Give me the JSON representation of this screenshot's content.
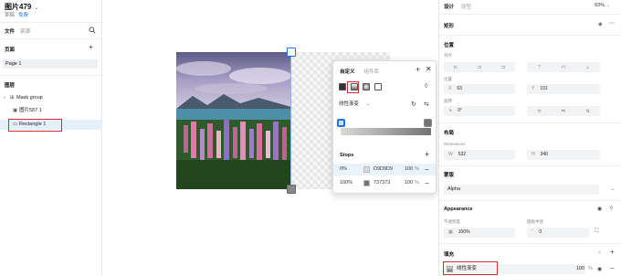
{
  "file": {
    "title": "图片479",
    "subtitle": "草稿",
    "link": "免费"
  },
  "left_tabs": [
    "文件",
    "资源"
  ],
  "pages_section": {
    "title": "页面",
    "items": [
      "Page 1"
    ]
  },
  "layers_section": {
    "title": "图层",
    "layers": [
      {
        "label": "Mask group",
        "icon": "⊞"
      },
      {
        "label": "图片587 1",
        "icon": "▣"
      },
      {
        "label": "Rectangle 1",
        "icon": "▭"
      }
    ]
  },
  "popup": {
    "tabs": [
      "自定义",
      "组件库"
    ],
    "gradient_type": "线性渐变",
    "stops_title": "Stops",
    "stops": [
      {
        "position": "0%",
        "hex": "D9D9D9",
        "opacity": "100",
        "color": "#d9d9d9"
      },
      {
        "position": "100%",
        "hex": "737373",
        "opacity": "100",
        "color": "#737373"
      }
    ],
    "pct": "%"
  },
  "right_panel": {
    "tabs": [
      "设计",
      "原型"
    ],
    "zoom": "93%",
    "shape_title": "矩形",
    "position_title": "位置",
    "align_label": "对齐",
    "position_label": "位置",
    "x": "63",
    "y": "101",
    "x_key": "X",
    "y_key": "Y",
    "rotation_label": "旋转",
    "rotation": "0°",
    "layout_title": "布局",
    "dimensions_label": "Dimensions",
    "w_key": "W",
    "w": "532",
    "h_key": "H",
    "h": "340",
    "mask_title": "蒙版",
    "mask_value": "Alpha",
    "appearance_title": "Appearance",
    "opacity_label": "不透明度",
    "opacity": "100%",
    "radius_label": "圆角半径",
    "radius": "0",
    "fill_title": "填充",
    "fill_label": "线性渐变",
    "fill_opacity": "100",
    "pct": "%"
  },
  "colors": {
    "accent": "#1a73e8",
    "highlight": "#d32f2f"
  }
}
